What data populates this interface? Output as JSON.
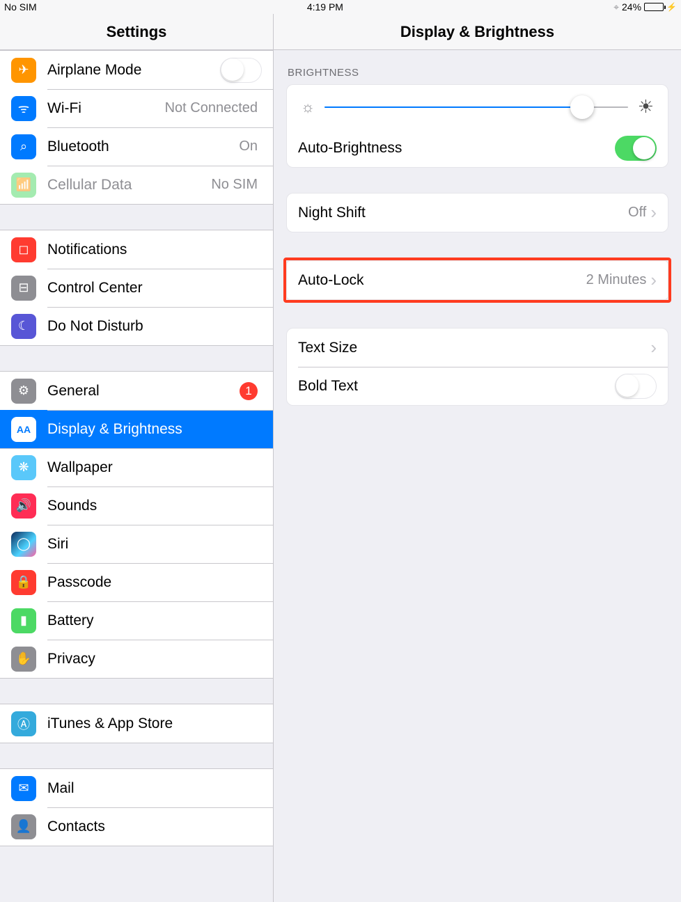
{
  "status": {
    "left": "No SIM",
    "time": "4:19 PM",
    "batteryPct": "24%",
    "batteryLevel": 24
  },
  "sidebar": {
    "title": "Settings",
    "groups": [
      [
        {
          "label": "Airplane Mode",
          "iconName": "airplane-icon",
          "glyph": "✈",
          "bg": "bg-orange",
          "control": "switch",
          "on": false
        },
        {
          "label": "Wi-Fi",
          "iconName": "wifi-icon",
          "glyph": "ᯤ",
          "bg": "bg-blue",
          "value": "Not Connected"
        },
        {
          "label": "Bluetooth",
          "iconName": "bluetooth-icon",
          "glyph": "⌕",
          "bg": "bg-blue",
          "value": "On"
        },
        {
          "label": "Cellular Data",
          "iconName": "cellular-icon",
          "glyph": "📶",
          "bg": "bg-green",
          "value": "No SIM",
          "disabled": true
        }
      ],
      [
        {
          "label": "Notifications",
          "iconName": "notifications-icon",
          "glyph": "◻",
          "bg": "bg-red"
        },
        {
          "label": "Control Center",
          "iconName": "control-center-icon",
          "glyph": "⊟",
          "bg": "bg-gray"
        },
        {
          "label": "Do Not Disturb",
          "iconName": "dnd-moon-icon",
          "glyph": "☾",
          "bg": "bg-purple"
        }
      ],
      [
        {
          "label": "General",
          "iconName": "gear-icon",
          "glyph": "⚙",
          "bg": "bg-gray",
          "badge": "1"
        },
        {
          "label": "Display & Brightness",
          "iconName": "display-brightness-icon",
          "glyph": "AA",
          "bg": "bg-blue",
          "selected": true
        },
        {
          "label": "Wallpaper",
          "iconName": "wallpaper-icon",
          "glyph": "❋",
          "bg": "bg-teal"
        },
        {
          "label": "Sounds",
          "iconName": "sounds-icon",
          "glyph": "🔊",
          "bg": "bg-crimson"
        },
        {
          "label": "Siri",
          "iconName": "siri-icon",
          "glyph": "◯",
          "bg": "bg-siri"
        },
        {
          "label": "Passcode",
          "iconName": "passcode-icon",
          "glyph": "🔒",
          "bg": "bg-red"
        },
        {
          "label": "Battery",
          "iconName": "battery-icon",
          "glyph": "▮",
          "bg": "bg-green"
        },
        {
          "label": "Privacy",
          "iconName": "privacy-icon",
          "glyph": "✋",
          "bg": "bg-gray"
        }
      ],
      [
        {
          "label": "iTunes & App Store",
          "iconName": "appstore-icon",
          "glyph": "Ⓐ",
          "bg": "bg-lightblue"
        }
      ],
      [
        {
          "label": "Mail",
          "iconName": "mail-icon",
          "glyph": "✉",
          "bg": "bg-blue"
        },
        {
          "label": "Contacts",
          "iconName": "contacts-icon",
          "glyph": "👤",
          "bg": "bg-gray"
        }
      ]
    ]
  },
  "detail": {
    "title": "Display & Brightness",
    "brightness": {
      "header": "BRIGHTNESS",
      "level": 85,
      "autoLabel": "Auto-Brightness",
      "autoOn": true
    },
    "nightShift": {
      "label": "Night Shift",
      "value": "Off"
    },
    "autoLock": {
      "label": "Auto-Lock",
      "value": "2 Minutes"
    },
    "text": {
      "sizeLabel": "Text Size",
      "boldLabel": "Bold Text",
      "boldOn": false
    }
  }
}
